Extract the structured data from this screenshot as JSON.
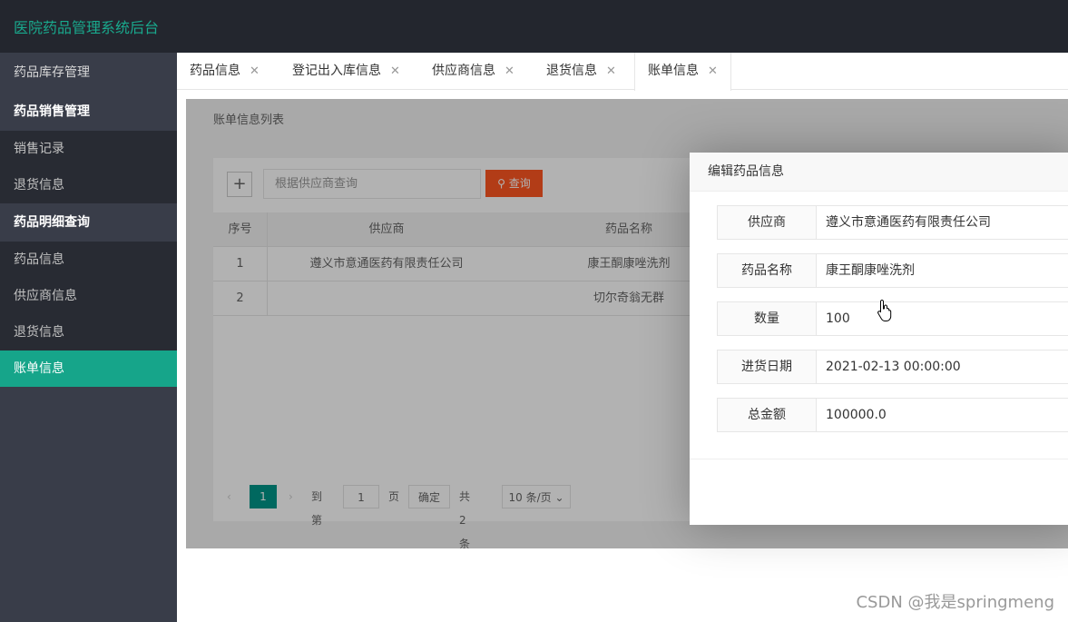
{
  "app": {
    "title": "医院药品管理系统后台"
  },
  "sidebar": {
    "groups": [
      {
        "label": "药品库存管理"
      },
      {
        "label": "药品销售管理"
      },
      {
        "label": "药品明细查询"
      }
    ],
    "items": [
      {
        "label": "销售记录"
      },
      {
        "label": "退货信息"
      },
      {
        "label": "药品信息"
      },
      {
        "label": "供应商信息"
      },
      {
        "label": "退货信息"
      },
      {
        "label": "账单信息"
      }
    ],
    "active_color": "#16a58a"
  },
  "tabs": [
    {
      "label": "药品信息"
    },
    {
      "label": "登记出入库信息"
    },
    {
      "label": "供应商信息"
    },
    {
      "label": "退货信息"
    },
    {
      "label": "账单信息"
    }
  ],
  "tab_close_glyph": "✕",
  "main": {
    "list_title": "账单信息列表",
    "add_icon": "+",
    "search_placeholder": "根据供应商查询",
    "search_button": "查询",
    "table": {
      "headers": [
        "序号",
        "供应商",
        "药品名称"
      ],
      "rows": [
        [
          "1",
          "遵义市意通医药有限责任公司",
          "康王酮康唑洗剂"
        ],
        [
          "2",
          "",
          "切尔奇翁无群"
        ]
      ]
    },
    "pager": {
      "current": "1",
      "goto_prefix": "到第",
      "goto_value": "1",
      "page_suffix": "页",
      "confirm": "确定",
      "total": "共 2 条",
      "page_size": "10 条/页"
    }
  },
  "dialog": {
    "title": "编辑药品信息",
    "fields": [
      {
        "label": "供应商",
        "value": "遵义市意通医药有限责任公司"
      },
      {
        "label": "药品名称",
        "value": "康王酮康唑洗剂"
      },
      {
        "label": "数量",
        "value": "100"
      },
      {
        "label": "进货日期",
        "value": "2021-02-13 00:00:00"
      },
      {
        "label": "总金额",
        "value": "100000.0"
      }
    ]
  },
  "watermark": "CSDN @我是springmeng"
}
